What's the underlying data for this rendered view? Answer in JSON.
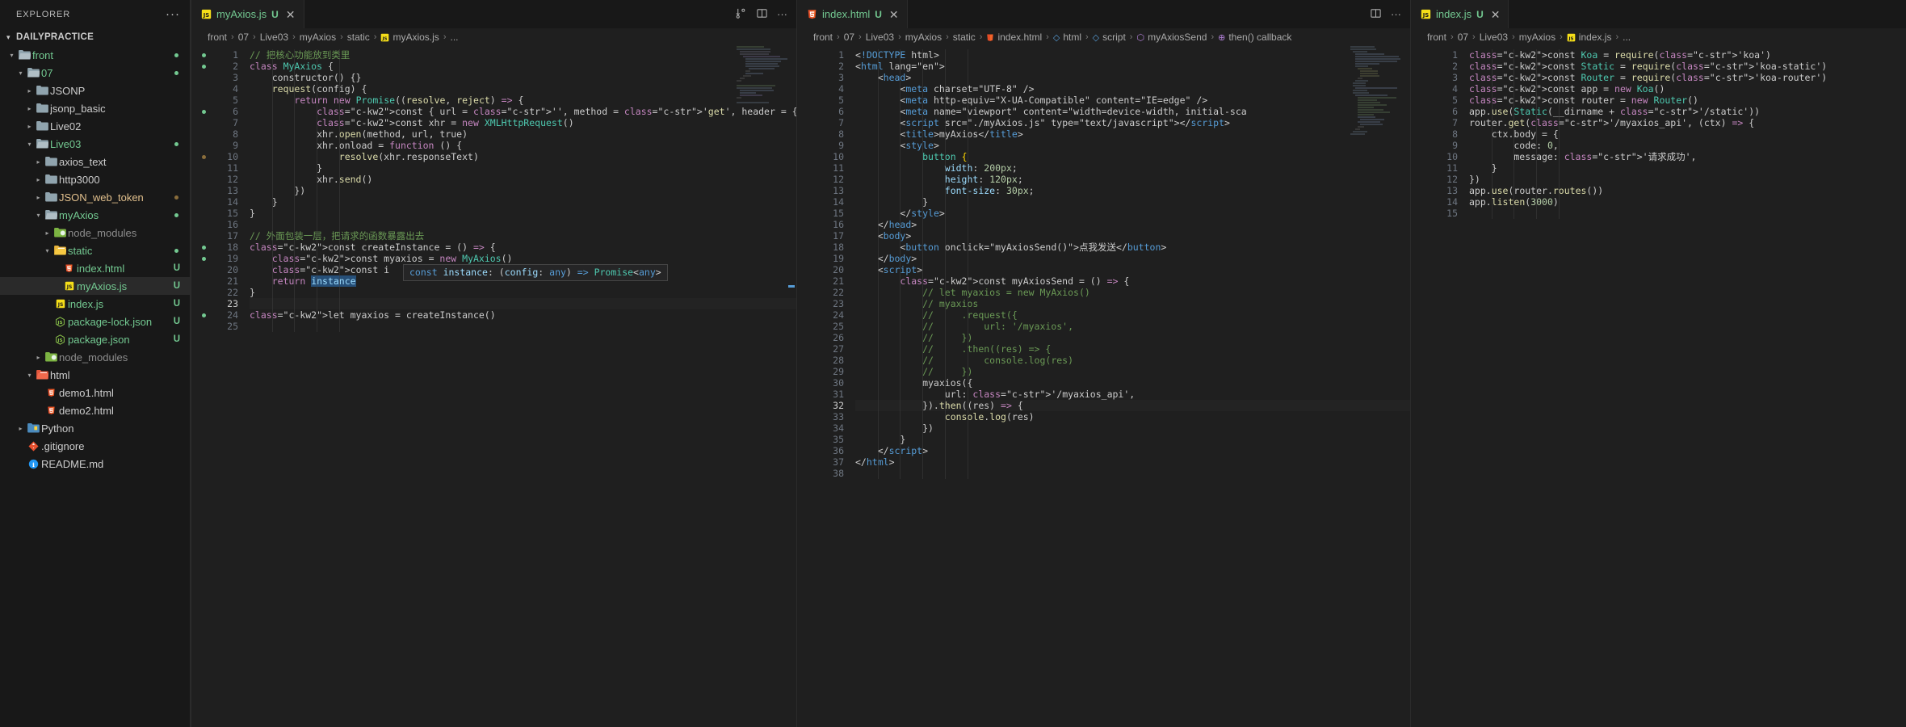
{
  "sidebar": {
    "header_title": "EXPLORER",
    "more_actions": "···",
    "root_label": "DAILYPRACTICE",
    "items": [
      {
        "label": "front",
        "depth": 1,
        "type": "folder-open",
        "color": "#73c991",
        "badge": "",
        "dot": "#73c991",
        "icon": "folder-open-icon"
      },
      {
        "label": "07",
        "depth": 2,
        "type": "folder-open",
        "color": "#73c991",
        "badge": "",
        "dot": "#73c991",
        "icon": "folder-open-icon"
      },
      {
        "label": "JSONP",
        "depth": 3,
        "type": "folder",
        "color": "#cccccc",
        "badge": "",
        "dot": "",
        "icon": "folder-icon"
      },
      {
        "label": "jsonp_basic",
        "depth": 3,
        "type": "folder",
        "color": "#cccccc",
        "badge": "",
        "dot": "",
        "icon": "folder-icon"
      },
      {
        "label": "Live02",
        "depth": 3,
        "type": "folder",
        "color": "#cccccc",
        "badge": "",
        "dot": "",
        "icon": "folder-icon"
      },
      {
        "label": "Live03",
        "depth": 3,
        "type": "folder-open",
        "color": "#73c991",
        "badge": "",
        "dot": "#73c991",
        "icon": "folder-open-icon"
      },
      {
        "label": "axios_text",
        "depth": 4,
        "type": "folder",
        "color": "#cccccc",
        "badge": "",
        "dot": "",
        "icon": "folder-icon"
      },
      {
        "label": "http3000",
        "depth": 4,
        "type": "folder",
        "color": "#cccccc",
        "badge": "",
        "dot": "",
        "icon": "folder-icon"
      },
      {
        "label": "JSON_web_token",
        "depth": 4,
        "type": "folder",
        "color": "#e2c08d",
        "badge": "",
        "dot": "#8a6d3b",
        "icon": "folder-icon"
      },
      {
        "label": "myAxios",
        "depth": 4,
        "type": "folder-open",
        "color": "#73c991",
        "badge": "",
        "dot": "#73c991",
        "icon": "folder-open-icon"
      },
      {
        "label": "node_modules",
        "depth": 5,
        "type": "node",
        "color": "#8c8c8c",
        "badge": "",
        "dot": "",
        "icon": "node-modules-icon"
      },
      {
        "label": "static",
        "depth": 5,
        "type": "folder-open-yellow",
        "color": "#73c991",
        "badge": "",
        "dot": "#73c991",
        "icon": "folder-open-icon"
      },
      {
        "label": "index.html",
        "depth": 6,
        "type": "html",
        "color": "#73c991",
        "badge": "U",
        "dot": "",
        "icon": "html5-icon"
      },
      {
        "label": "myAxios.js",
        "depth": 6,
        "type": "js",
        "color": "#73c991",
        "badge": "U",
        "dot": "",
        "selected": true,
        "icon": "javascript-icon"
      },
      {
        "label": "index.js",
        "depth": 5,
        "type": "js",
        "color": "#73c991",
        "badge": "U",
        "dot": "",
        "icon": "javascript-icon"
      },
      {
        "label": "package-lock.json",
        "depth": 5,
        "type": "npm",
        "color": "#73c991",
        "badge": "U",
        "dot": "",
        "icon": "nodejs-icon"
      },
      {
        "label": "package.json",
        "depth": 5,
        "type": "npm",
        "color": "#73c991",
        "badge": "U",
        "dot": "",
        "icon": "nodejs-icon"
      },
      {
        "label": "node_modules",
        "depth": 4,
        "type": "node",
        "color": "#8c8c8c",
        "badge": "",
        "dot": "",
        "icon": "node-modules-icon"
      },
      {
        "label": "html",
        "depth": 3,
        "type": "folder-open-html",
        "color": "#cccccc",
        "badge": "",
        "dot": "",
        "icon": "folder-open-icon"
      },
      {
        "label": "demo1.html",
        "depth": 4,
        "type": "html",
        "color": "#cccccc",
        "badge": "",
        "dot": "",
        "icon": "html5-icon"
      },
      {
        "label": "demo2.html",
        "depth": 4,
        "type": "html",
        "color": "#cccccc",
        "badge": "",
        "dot": "",
        "icon": "html5-icon"
      },
      {
        "label": "Python",
        "depth": 2,
        "type": "python-folder",
        "color": "#cccccc",
        "badge": "",
        "dot": "",
        "icon": "folder-icon"
      },
      {
        "label": ".gitignore",
        "depth": 2,
        "type": "git",
        "color": "#cccccc",
        "badge": "",
        "dot": "",
        "icon": "git-icon"
      },
      {
        "label": "README.md",
        "depth": 2,
        "type": "info",
        "color": "#cccccc",
        "badge": "",
        "dot": "",
        "icon": "info-icon"
      }
    ]
  },
  "groups": [
    {
      "tab": {
        "name": "myAxios.js",
        "badge": "U",
        "close": "✕",
        "icon": "javascript-icon"
      },
      "actions": [
        "split-editor-icon",
        "more-actions-icon"
      ],
      "breadcrumb": [
        "front",
        "07",
        "Live03",
        "myAxios",
        "static",
        "myAxios.js",
        "..."
      ],
      "line_count": 25,
      "current_line": 23,
      "tooltip": {
        "text": "const instance: (config: any) => Promise<any>",
        "line": 20
      }
    },
    {
      "tab": {
        "name": "index.html",
        "badge": "U",
        "close": "✕",
        "icon": "html5-icon"
      },
      "actions": [
        "split-editor-icon",
        "more-actions-icon"
      ],
      "breadcrumb": [
        "front",
        "07",
        "Live03",
        "myAxios",
        "static",
        "index.html",
        "html",
        "script",
        "myAxiosSend",
        "then() callback"
      ],
      "line_count": 38,
      "current_line": 32
    },
    {
      "tab": {
        "name": "index.js",
        "badge": "U",
        "close": "✕",
        "icon": "javascript-icon"
      },
      "actions": [],
      "breadcrumb": [
        "front",
        "07",
        "Live03",
        "myAxios",
        "index.js",
        "..."
      ],
      "line_count": 15,
      "current_line": 0
    }
  ],
  "code": {
    "myAxios_js": [
      "// 把核心功能放到类里",
      "class MyAxios {",
      "    constructor() {}",
      "    request(config) {",
      "        return new Promise((resolve, reject) => {",
      "            const { url = '', method = 'get', header = {} } = config",
      "            const xhr = new XMLHttpRequest()",
      "            xhr.open(method, url, true)",
      "            xhr.onload = function () {",
      "                resolve(xhr.responseText)",
      "            }",
      "            xhr.send()",
      "        })",
      "    }",
      "}",
      "",
      "// 外面包装一层，把请求的函数暴露出去",
      "const createInstance = () => {",
      "    const myaxios = new MyAxios()",
      "    const i",
      "    return instance",
      "}",
      "",
      "let myaxios = createInstance()",
      ""
    ],
    "index_html": [
      "<!DOCTYPE html>",
      "<html lang=\"en\">",
      "    <head>",
      "        <meta charset=\"UTF-8\" />",
      "        <meta http-equiv=\"X-UA-Compatible\" content=\"IE=edge\" />",
      "        <meta name=\"viewport\" content=\"width=device-width, initial-sca",
      "        <script src=\"./myAxios.js\" type=\"text/javascript\"></script>",
      "        <title>myAxios</title>",
      "        <style>",
      "            button {",
      "                width: 200px;",
      "                height: 120px;",
      "                font-size: 30px;",
      "            }",
      "        </style>",
      "    </head>",
      "    <body>",
      "        <button onclick=\"myAxiosSend()\">点我发送</button>",
      "    </body>",
      "    <script>",
      "        const myAxiosSend = () => {",
      "            // let myaxios = new MyAxios()",
      "            // myaxios",
      "            //     .request({",
      "            //         url: '/myaxios',",
      "            //     })",
      "            //     .then((res) => {",
      "            //         console.log(res)",
      "            //     })",
      "            myaxios({",
      "                url: '/myaxios_api',",
      "            }).then((res) => {",
      "                console.log(res)",
      "            })",
      "        }",
      "    </script>",
      "</html>",
      ""
    ],
    "index_js": [
      "const Koa = require('koa')",
      "const Static = require('koa-static')",
      "const Router = require('koa-router')",
      "const app = new Koa()",
      "const router = new Router()",
      "app.use(Static(__dirname + '/static'))",
      "router.get('/myaxios_api', (ctx) => {",
      "    ctx.body = {",
      "        code: 0,",
      "        message: '请求成功',",
      "    }",
      "})",
      "app.use(router.routes())",
      "app.listen(3000)",
      ""
    ]
  },
  "colors": {
    "accent": "#0078d4",
    "background": "#1f1f1f",
    "sidebar_bg": "#181818",
    "tabbar_bg": "#181818",
    "modified_green": "#73c991",
    "comment_green": "#6a9955",
    "string_orange": "#ce9178",
    "keyword_purple": "#c586c0",
    "keyword_blue": "#569cd6",
    "function_yellow": "#dcdcaa",
    "class_teal": "#4ec9b0",
    "variable_lightblue": "#9cdcfe"
  }
}
